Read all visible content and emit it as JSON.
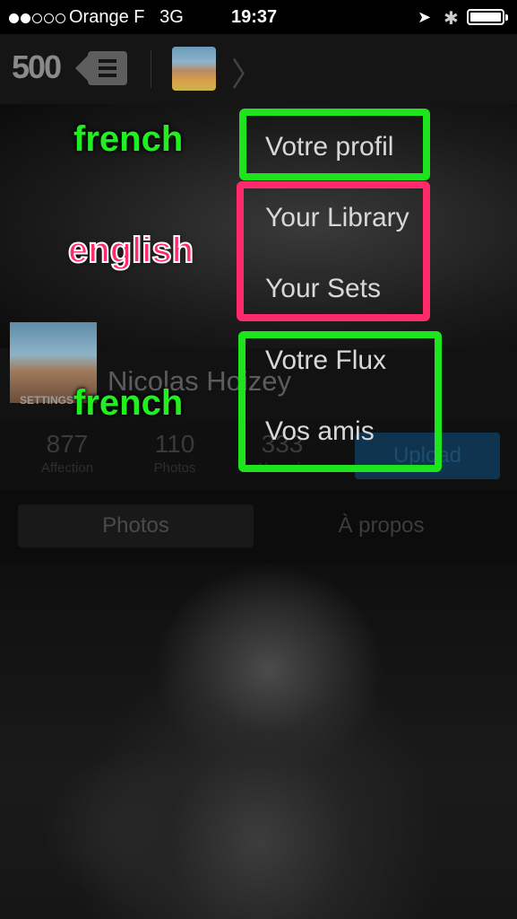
{
  "status_bar": {
    "carrier": "Orange F",
    "network": "3G",
    "time": "19:37"
  },
  "nav": {
    "logo": "500"
  },
  "menu": {
    "items": [
      {
        "label": "Votre profil"
      },
      {
        "label": "Your Library"
      },
      {
        "label": "Your Sets"
      },
      {
        "label": "Votre Flux"
      },
      {
        "label": "Vos amis"
      }
    ]
  },
  "annotations": {
    "french_top": "french",
    "english": "english",
    "french_bottom": "french"
  },
  "profile": {
    "name": "Nicolas Hoizey",
    "settings_label": "SETTINGS",
    "stats": [
      {
        "value": "877",
        "label": "Affection"
      },
      {
        "value": "110",
        "label": "Photos"
      },
      {
        "value": "333",
        "label": "Abonnés"
      }
    ],
    "upload_label": "Upload",
    "tabs": [
      {
        "label": "Photos"
      },
      {
        "label": "À propos"
      }
    ]
  },
  "colors": {
    "annotation_green": "#1ee41e",
    "annotation_pink": "#ff2a6a",
    "upload_button": "#0e3450"
  }
}
